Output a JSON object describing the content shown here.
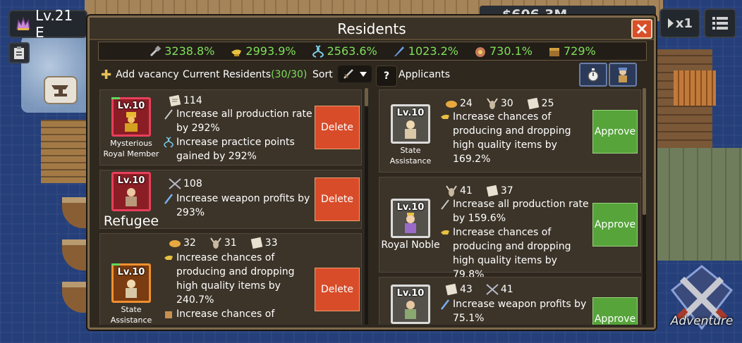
{
  "hud": {
    "level_text": "Lv.21 E",
    "gold_text": "$606.3M",
    "speed_text": "x1"
  },
  "panel": {
    "title": "Residents",
    "stats": [
      {
        "icon": "hammer-icon",
        "value": "3238.8%"
      },
      {
        "icon": "lamp-icon",
        "value": "2993.9%"
      },
      {
        "icon": "dna-icon",
        "value": "2563.6%"
      },
      {
        "icon": "quill-icon",
        "value": "1023.2%"
      },
      {
        "icon": "coin-bag-icon",
        "value": "730.1%"
      },
      {
        "icon": "chest-icon",
        "value": "729%"
      }
    ],
    "add_vacancy": "Add vacancy",
    "current_residents_label": "Current Residents",
    "current_residents_count": "(30/30)",
    "sort_label": "Sort",
    "help_label": "?",
    "applicants_label": "Applicants",
    "adventure_label": "Adventure"
  },
  "residents": [
    {
      "level": "Lv.10",
      "name": "Mysterious Royal Member",
      "reqs": [
        {
          "icon": "scroll-icon",
          "value": "114"
        }
      ],
      "effects": [
        {
          "icon": "sword-icon",
          "text": "Increase all production rate by 292%"
        },
        {
          "icon": "dna-icon",
          "text": "Increase practice points gained by 292%"
        }
      ],
      "action": "Delete"
    },
    {
      "level": "Lv.10",
      "name": "Refugee",
      "reqs": [
        {
          "icon": "crossed-swords-icon",
          "value": "108"
        }
      ],
      "effects": [
        {
          "icon": "dagger-icon",
          "text": "Increase weapon profits by 293%"
        }
      ],
      "action": "Delete"
    },
    {
      "level": "Lv.10",
      "name": "State Assistance",
      "reqs": [
        {
          "icon": "bread-icon",
          "value": "32"
        },
        {
          "icon": "goat-icon",
          "value": "31"
        },
        {
          "icon": "scroll-icon",
          "value": "33"
        }
      ],
      "effects": [
        {
          "icon": "lamp-icon",
          "text": "Increase chances of producing and dropping high quality items by 240.7%"
        },
        {
          "icon": "bag-icon",
          "text": "Increase chances of"
        }
      ],
      "action": "Delete"
    }
  ],
  "applicants": [
    {
      "level": "Lv.10",
      "name": "State Assistance",
      "reqs": [
        {
          "icon": "bread-icon",
          "value": "24"
        },
        {
          "icon": "goat-icon",
          "value": "30"
        },
        {
          "icon": "scroll-icon",
          "value": "25"
        }
      ],
      "effects": [
        {
          "icon": "lamp-icon",
          "text": "Increase chances of producing and dropping high quality items by 169.2%"
        }
      ],
      "action": "Approve"
    },
    {
      "level": "Lv.10",
      "name": "Royal Noble",
      "reqs": [
        {
          "icon": "goat-icon",
          "value": "41"
        },
        {
          "icon": "scroll-icon",
          "value": "37"
        }
      ],
      "effects": [
        {
          "icon": "sword-icon",
          "text": "Increase all production rate by 159.6%"
        },
        {
          "icon": "lamp-icon",
          "text": "Increase chances of producing and dropping high quality items by 79.8%"
        }
      ],
      "action": "Approve"
    },
    {
      "level": "Lv.10",
      "name": "",
      "reqs": [
        {
          "icon": "scroll-icon",
          "value": "43"
        },
        {
          "icon": "crossed-swords-icon",
          "value": "41"
        }
      ],
      "effects": [
        {
          "icon": "dagger-icon",
          "text": "Increase weapon profits by 75.1%"
        }
      ],
      "action": "Approve"
    }
  ],
  "colors": {
    "stat_green": "#7fe05a",
    "delete_red": "#d84c2a",
    "approve_green": "#56a43a",
    "panel_bg": "#2e281f"
  }
}
